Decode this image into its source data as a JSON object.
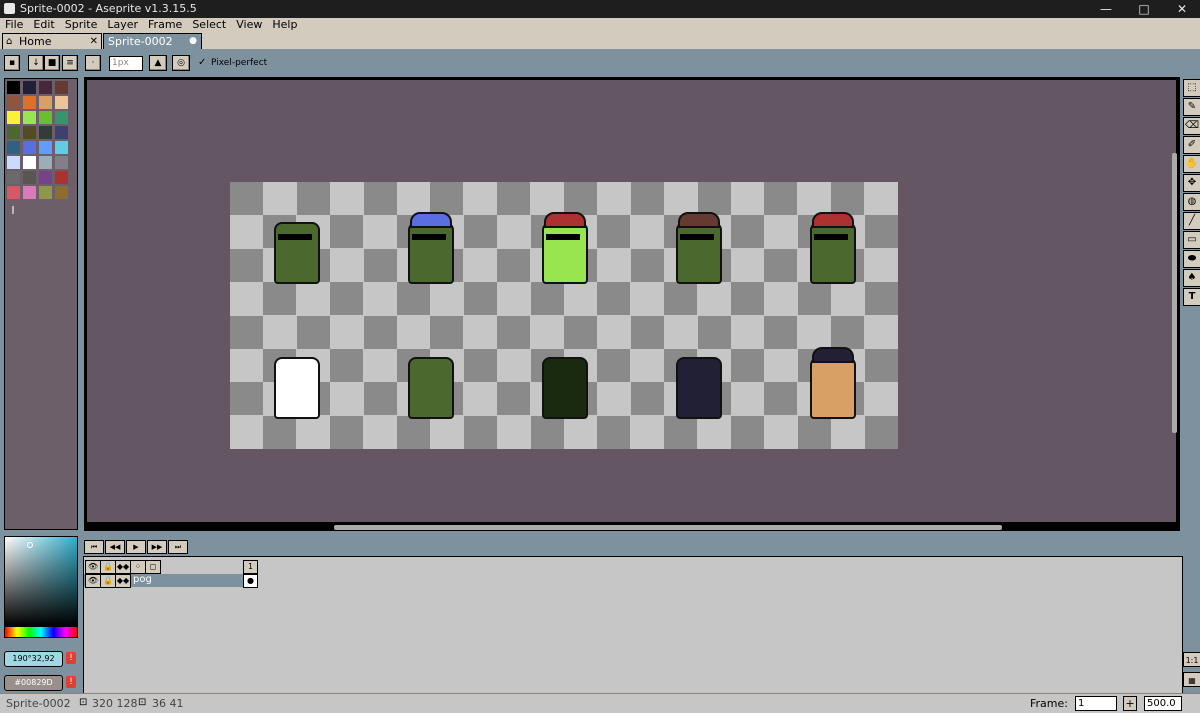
{
  "window": {
    "title": "Sprite-0002 - Aseprite v1.3.15.5",
    "min": "—",
    "max": "□",
    "close": "✕"
  },
  "menu": [
    "File",
    "Edit",
    "Sprite",
    "Layer",
    "Frame",
    "Select",
    "View",
    "Help"
  ],
  "tabs": {
    "home": "Home",
    "home_close": "✕",
    "sprite": "Sprite-0002",
    "sprite_dot": "●"
  },
  "context": {
    "brush_size_placeholder": "1px",
    "pixel_perfect": "Pixel-perfect",
    "check": "✓"
  },
  "palette": {
    "colors": [
      "#000000",
      "#222034",
      "#45283c",
      "#663931",
      "#8f563b",
      "#df7126",
      "#d9a066",
      "#eec39a",
      "#fbf236",
      "#99e550",
      "#6abe30",
      "#37946e",
      "#4b692f",
      "#524b24",
      "#323c39",
      "#3f3f74",
      "#306082",
      "#5b6ee1",
      "#639bff",
      "#5fcde4",
      "#cbdbfc",
      "#ffffff",
      "#9badb7",
      "#847e87",
      "#696a6a",
      "#595652",
      "#76428a",
      "#ac3232",
      "#d95763",
      "#d77bba",
      "#8f974a",
      "#8a6f30"
    ],
    "marker": "‖"
  },
  "colors": {
    "fg": "190°32,92",
    "bg": "#00829D",
    "warn": "!"
  },
  "timeline": {
    "buttons": [
      "⏮",
      "◀◀",
      "▶",
      "▶▶",
      "⏭"
    ],
    "frame_number": "1",
    "layer_name": "pog",
    "icons": [
      "👁",
      "🔒",
      "◆◆",
      "⁘",
      "◻"
    ]
  },
  "status": {
    "sprite": "Sprite-0002",
    "size": "320 128",
    "pos": "36 41",
    "frame_label": "Frame:",
    "frame_value": "1",
    "plus": "+",
    "zoom": "500.0"
  },
  "tools": [
    "⬚",
    "✎",
    "⌫",
    "✐",
    "✋",
    "✥",
    "◍",
    "╱",
    "▭",
    "⬬",
    "♠",
    "T"
  ],
  "characters": [
    {
      "name": "frog-sunglasses",
      "body": "#4b692f"
    },
    {
      "name": "frog-propeller-hat",
      "body": "#4b692f",
      "hat": "#5b6ee1"
    },
    {
      "name": "frog-poop-hat",
      "body": "#99e550",
      "hat": "#ac3232"
    },
    {
      "name": "frog-santa-hat",
      "body": "#4b692f",
      "hat": "#663931"
    },
    {
      "name": "frog-red-cap",
      "body": "#4b692f",
      "hat": "#ac3232"
    },
    {
      "name": "white-cat",
      "body": "#ffffff"
    },
    {
      "name": "frog-striped-shirt",
      "body": "#4b692f"
    },
    {
      "name": "black-frog",
      "body": "#1a2a10"
    },
    {
      "name": "black-cat-cigarette",
      "body": "#222034"
    },
    {
      "name": "dog-top-hat",
      "body": "#d9a066",
      "hat": "#222034"
    }
  ]
}
